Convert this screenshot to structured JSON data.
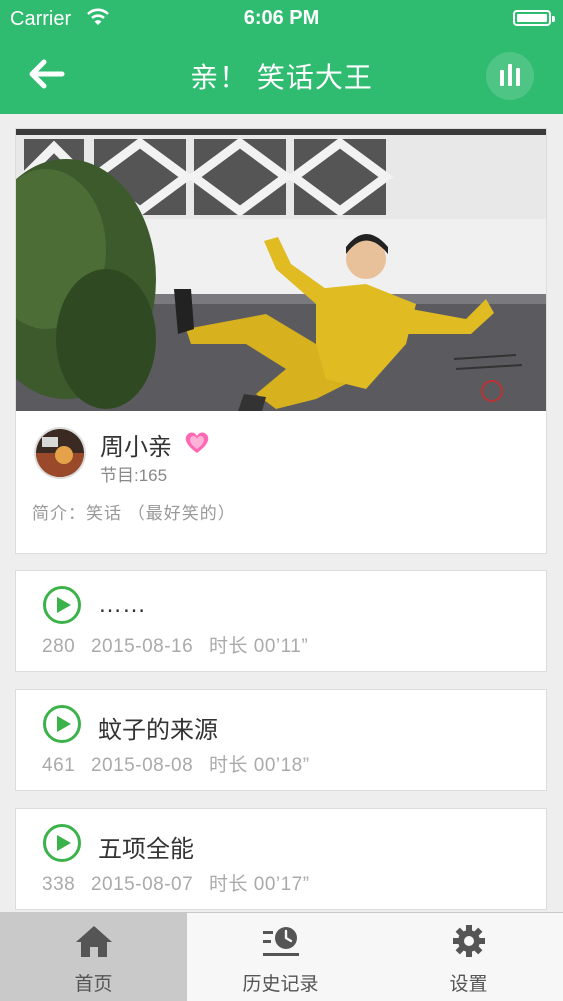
{
  "status_bar": {
    "carrier": "Carrier",
    "time": "6:06 PM"
  },
  "nav": {
    "title": "亲！ 笑话大王",
    "back_icon": "arrow-left-icon",
    "right_icon": "sound-bars-icon"
  },
  "colors": {
    "brand_green": "#2fbb70",
    "play_green": "#3cb24a"
  },
  "profile": {
    "name": "周小亲",
    "program_count": "节目:165",
    "intro": "简介：笑话 （最好笑的）"
  },
  "episodes": [
    {
      "title": "……",
      "plays": "280",
      "date": "2015-08-16",
      "duration": "时长 00’11”"
    },
    {
      "title": "蚊子的来源",
      "plays": "461",
      "date": "2015-08-08",
      "duration": "时长 00’18”"
    },
    {
      "title": "五项全能",
      "plays": "338",
      "date": "2015-08-07",
      "duration": "时长 00’17”"
    }
  ],
  "tabs": [
    {
      "label": "首页",
      "icon": "home-icon",
      "active": true
    },
    {
      "label": "历史记录",
      "icon": "history-icon",
      "active": false
    },
    {
      "label": "设置",
      "icon": "gear-icon",
      "active": false
    }
  ]
}
